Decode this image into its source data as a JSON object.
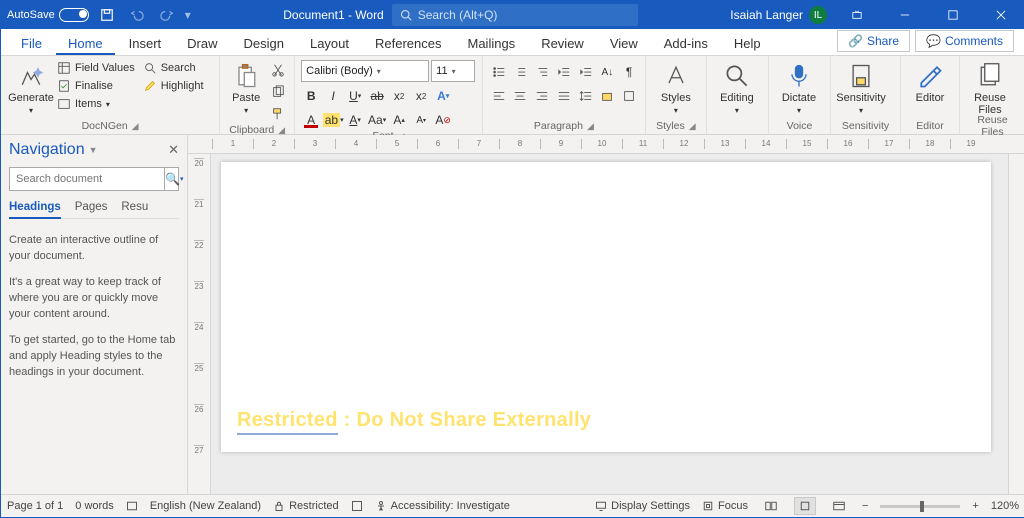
{
  "title": {
    "autosave": "AutoSave",
    "doc": "Document1 - Word",
    "search_placeholder": "Search (Alt+Q)",
    "user": "Isaiah Langer",
    "initials": "IL"
  },
  "menu": {
    "file": "File",
    "home": "Home",
    "insert": "Insert",
    "draw": "Draw",
    "design": "Design",
    "layout": "Layout",
    "references": "References",
    "mailings": "Mailings",
    "review": "Review",
    "view": "View",
    "addins": "Add-ins",
    "help": "Help",
    "share": "Share",
    "comments": "Comments"
  },
  "ribbon": {
    "docngen": {
      "label": "DocNGen",
      "generate": "Generate",
      "field_values": "Field Values",
      "finalise": "Finalise",
      "items": "Items",
      "search": "Search",
      "highlight": "Highlight"
    },
    "clipboard": {
      "label": "Clipboard",
      "paste": "Paste"
    },
    "font": {
      "label": "Font",
      "name": "Calibri (Body)",
      "size": "11"
    },
    "paragraph": {
      "label": "Paragraph"
    },
    "styles": {
      "label": "Styles",
      "btn": "Styles"
    },
    "editing": {
      "label": "Editing",
      "btn": "Editing"
    },
    "voice": {
      "label": "Voice",
      "btn": "Dictate"
    },
    "sensitivity": {
      "label": "Sensitivity",
      "btn": "Sensitivity"
    },
    "editor": {
      "label": "Editor",
      "btn": "Editor"
    },
    "reuse": {
      "label": "Reuse Files",
      "btn": "Reuse Files"
    }
  },
  "nav": {
    "title": "Navigation",
    "search_placeholder": "Search document",
    "tabs": {
      "headings": "Headings",
      "pages": "Pages",
      "results": "Resu"
    },
    "p1": "Create an interactive outline of your document.",
    "p2": "It's a great way to keep track of where you are or quickly move your content around.",
    "p3": "To get started, go to the Home tab and apply Heading styles to the headings in your document."
  },
  "page_footer": {
    "restricted": "Restricted",
    "rest": " : Do Not Share Externally"
  },
  "status": {
    "page": "Page 1 of 1",
    "words": "0 words",
    "lang": "English (New Zealand)",
    "restricted": "Restricted",
    "access": "Accessibility: Investigate",
    "display": "Display Settings",
    "focus": "Focus",
    "zoom": "120%"
  },
  "ruler": [
    "1",
    "2",
    "3",
    "4",
    "5",
    "6",
    "7",
    "8",
    "9",
    "10",
    "11",
    "12",
    "13",
    "14",
    "15",
    "16",
    "17",
    "18",
    "19"
  ],
  "vruler": [
    "20",
    "21",
    "22",
    "23",
    "24",
    "25",
    "26",
    "27"
  ]
}
